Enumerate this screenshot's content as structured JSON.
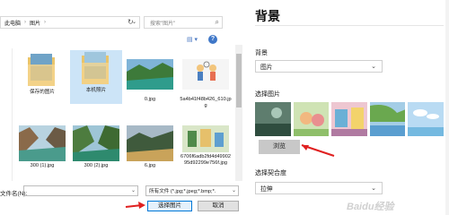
{
  "dialog": {
    "breadcrumb": [
      "此电脑",
      "图片"
    ],
    "search_placeholder": "搜索\"图片\"",
    "files": [
      {
        "name": "保存的图片",
        "kind": "folder"
      },
      {
        "name": "本机照片",
        "kind": "folder",
        "selected": true
      },
      {
        "name": "0.jpg",
        "kind": "image"
      },
      {
        "name": "5a4b41f48b426_610.jpg",
        "kind": "image"
      },
      {
        "name": "300 (1).jpg",
        "kind": "image"
      },
      {
        "name": "300 (2).jpg",
        "kind": "image"
      },
      {
        "name": "6.jpg",
        "kind": "image"
      },
      {
        "name": "6706f6adb2fd4d4990295d92299e756f.jpg",
        "kind": "image"
      }
    ],
    "filename_label": "文件名(N):",
    "filename_value": "",
    "filetype_value": "所有文件 (*.jpg;*.jpeg;*.bmp;*.",
    "choose_label": "选择图片",
    "cancel_label": "取消"
  },
  "settings": {
    "title": "背景",
    "background_label": "背景",
    "background_value": "图片",
    "choose_picture_label": "选择图片",
    "browse_label": "浏览",
    "fit_label": "选择契合度",
    "fit_value": "拉伸"
  },
  "watermark": "Baidu经验",
  "colors": {
    "accent": "#0078d7",
    "arrow_red": "#e02020",
    "selected_bg": "#cce4f7"
  },
  "icons": [
    "chevron-down-icon",
    "refresh-icon",
    "search-icon",
    "view-icon",
    "help-icon",
    "folder-icon"
  ]
}
